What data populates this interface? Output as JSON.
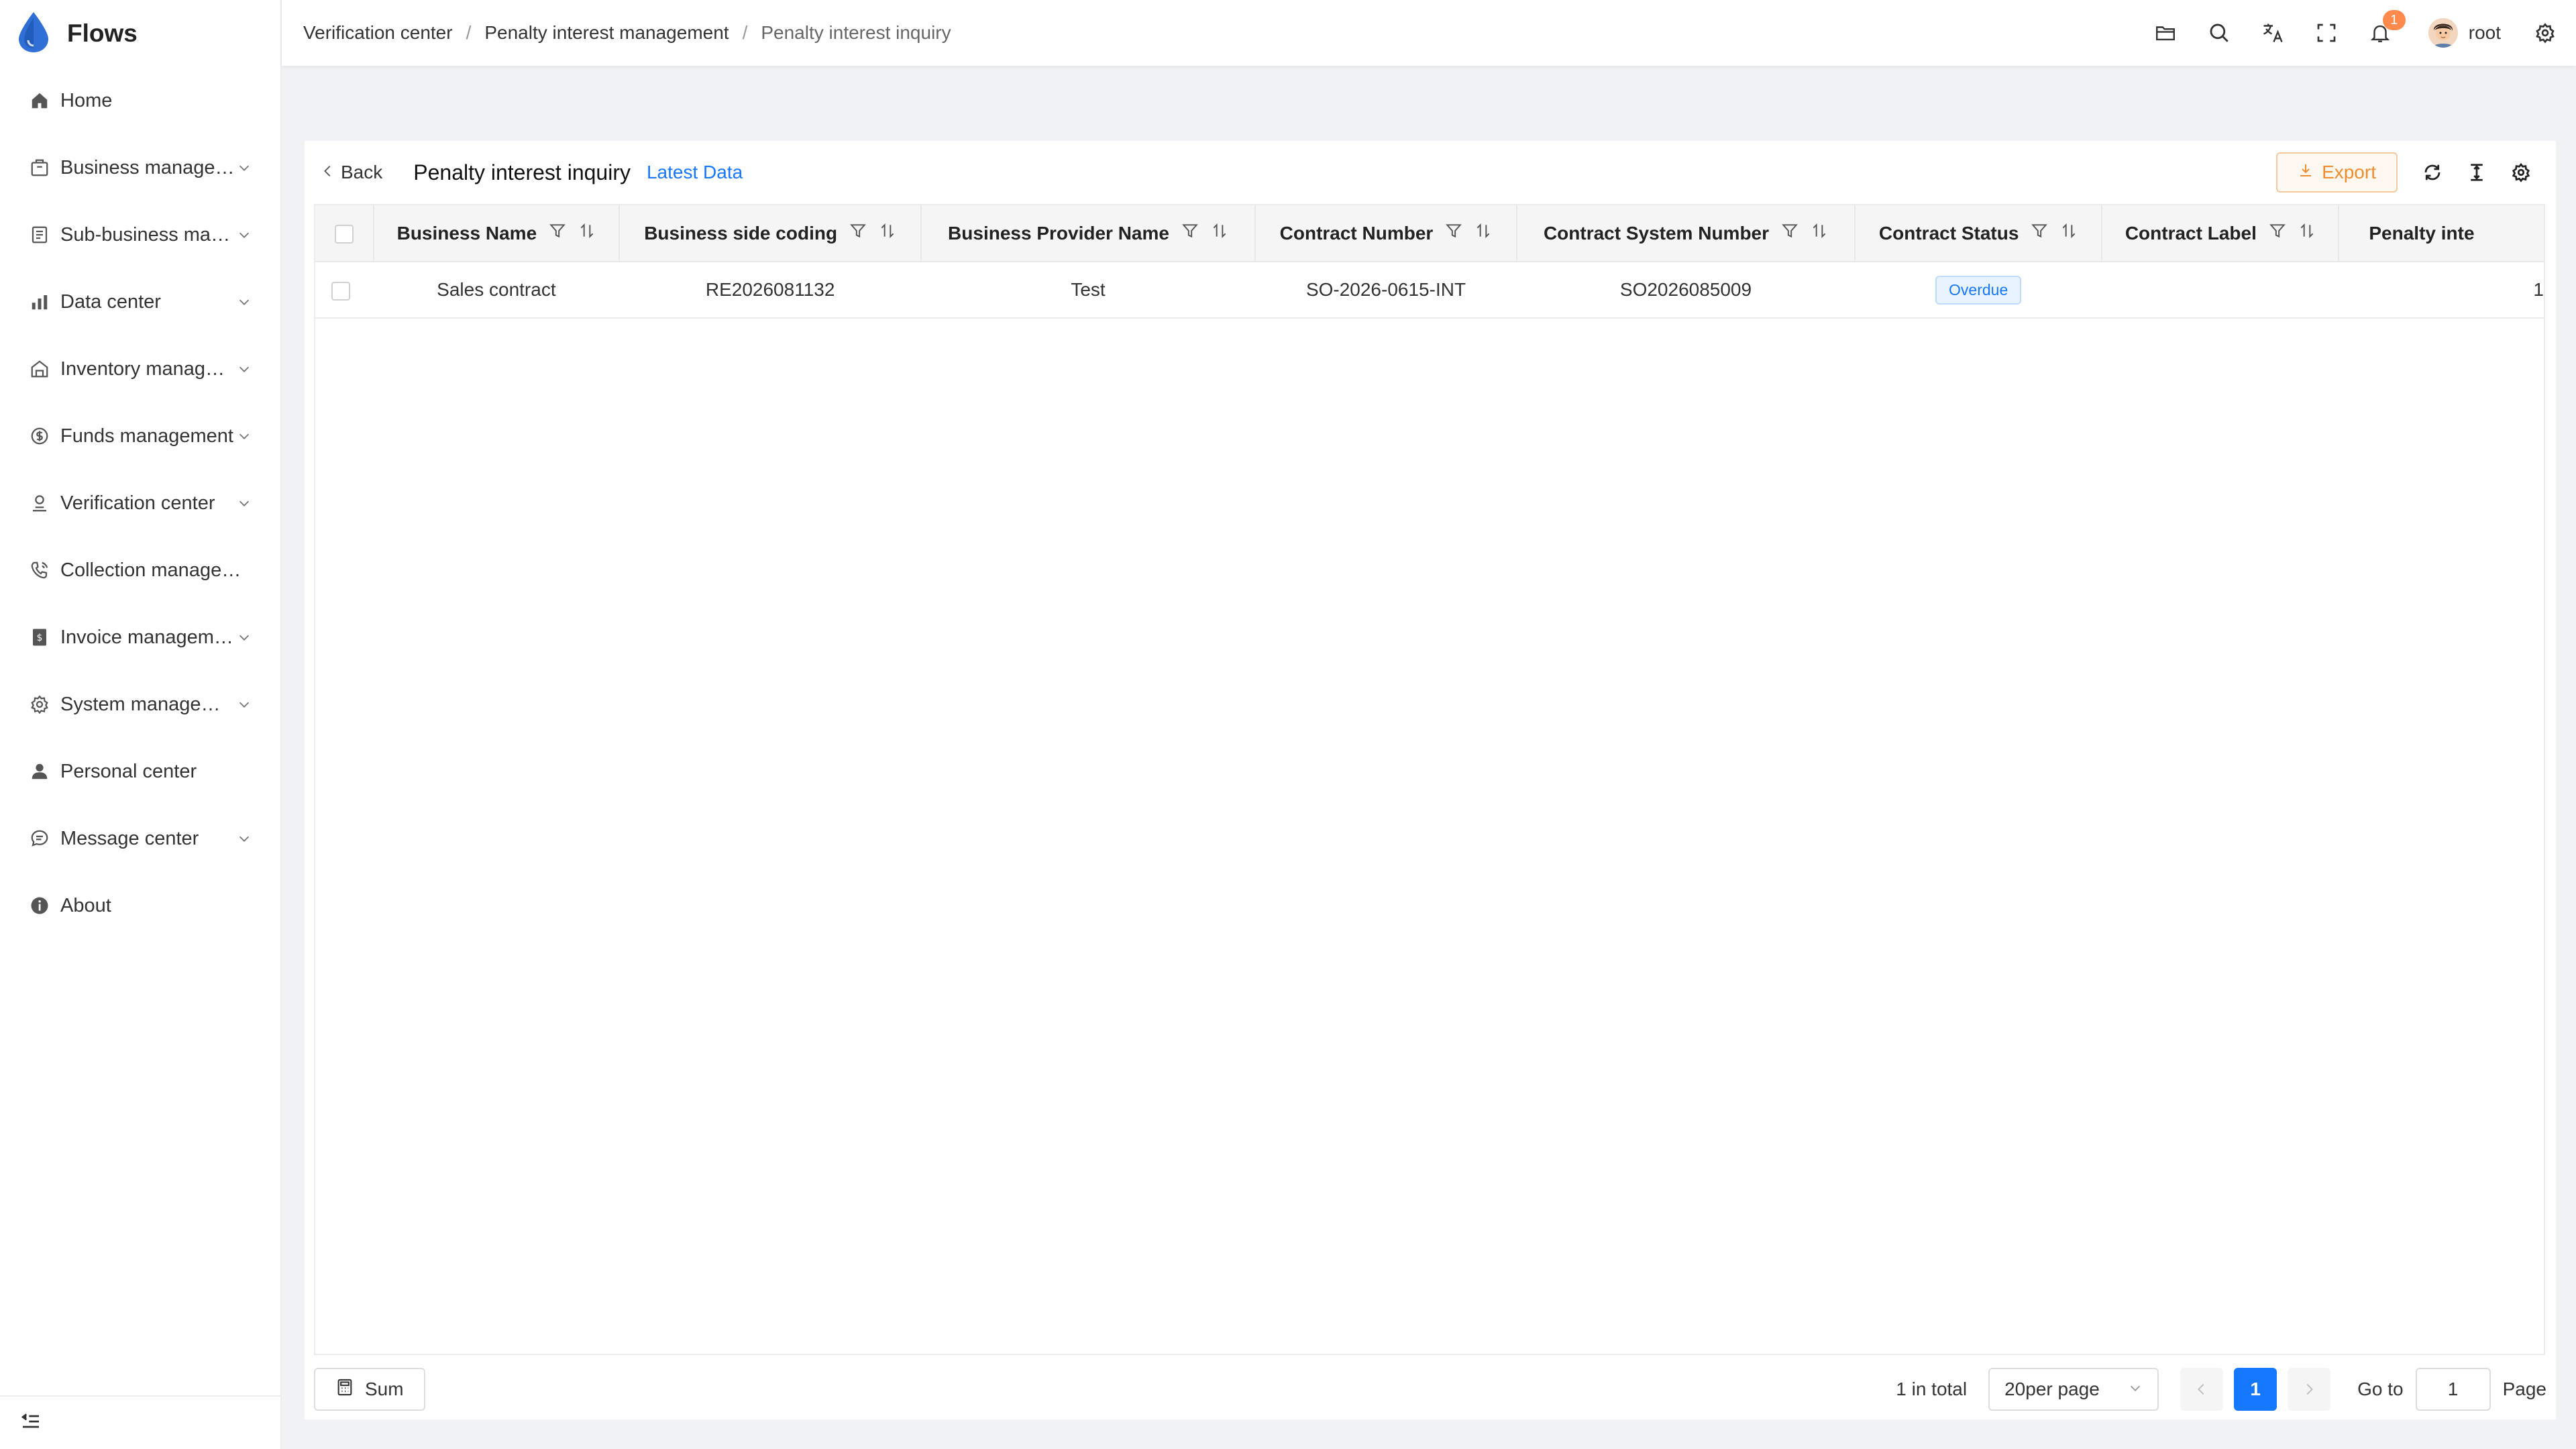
{
  "app": {
    "name": "Flows"
  },
  "sidebar": {
    "items": [
      {
        "label": "Home",
        "icon": "home-icon",
        "expandable": false
      },
      {
        "label": "Business management",
        "icon": "briefcase-icon",
        "expandable": true
      },
      {
        "label": "Sub-business management",
        "icon": "document-icon",
        "expandable": true
      },
      {
        "label": "Data center",
        "icon": "bar-chart-icon",
        "expandable": true
      },
      {
        "label": "Inventory management",
        "icon": "warehouse-icon",
        "expandable": true
      },
      {
        "label": "Funds management",
        "icon": "dollar-circle-icon",
        "expandable": true
      },
      {
        "label": "Verification center",
        "icon": "user-check-icon",
        "expandable": true
      },
      {
        "label": "Collection management",
        "icon": "phone-icon",
        "expandable": false
      },
      {
        "label": "Invoice management",
        "icon": "invoice-icon",
        "expandable": true
      },
      {
        "label": "System management",
        "icon": "gear-icon",
        "expandable": true
      },
      {
        "label": "Personal center",
        "icon": "person-icon",
        "expandable": false
      },
      {
        "label": "Message center",
        "icon": "chat-icon",
        "expandable": true
      },
      {
        "label": "About",
        "icon": "info-icon",
        "expandable": false
      }
    ]
  },
  "header": {
    "breadcrumb": [
      "Verification center",
      "Penalty interest management",
      "Penalty interest inquiry"
    ],
    "notification_count": "1",
    "username": "root"
  },
  "page": {
    "back_label": "Back",
    "title": "Penalty interest inquiry",
    "latest_link": "Latest Data",
    "export_label": "Export"
  },
  "table": {
    "columns": [
      "Business Name",
      "Business side coding",
      "Business Provider Name",
      "Contract Number",
      "Contract System Number",
      "Contract Status",
      "Contract Label",
      "Penalty inte"
    ],
    "rows": [
      {
        "business_name": "Sales contract",
        "business_side_coding": "RE2026081132",
        "business_provider_name": "Test",
        "contract_number": "SO-2026-0615-INT",
        "contract_system_number": "SO2026085009",
        "contract_status": "Overdue",
        "contract_label": "",
        "penalty_partial": "1"
      }
    ]
  },
  "footer": {
    "sum_label": "Sum",
    "total": "1 in total",
    "page_size": "20per page",
    "current_page": "1",
    "goto_label": "Go to",
    "goto_value": "1",
    "page_label": "Page"
  },
  "colors": {
    "primary": "#1677ff",
    "export": "#f08c2e",
    "badge": "#ff8a4c",
    "logo": "#2f6fd6"
  }
}
